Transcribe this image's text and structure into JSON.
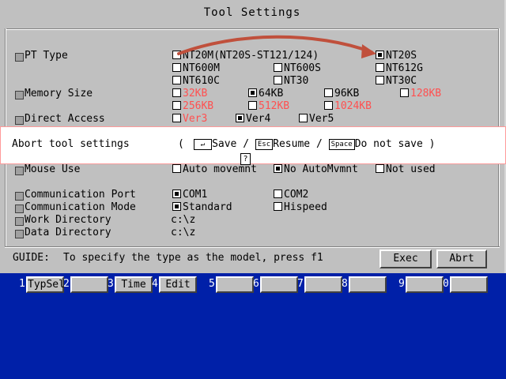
{
  "window": {
    "title": "Tool Settings"
  },
  "settings": {
    "pt_type": {
      "label": "PT Type",
      "options": [
        "NT20M(NT20S-ST121/124)",
        "NT20S",
        "NT600M",
        "NT600S",
        "NT612G",
        "NT610C",
        "NT30",
        "NT30C"
      ],
      "selected": "NT20S"
    },
    "memory_size": {
      "label": "Memory Size",
      "options": [
        "32KB",
        "64KB",
        "96KB",
        "128KB",
        "256KB",
        "512KB",
        "1024KB"
      ],
      "selected": "64KB"
    },
    "direct_access": {
      "label": "Direct Access",
      "options": [
        "Ver3",
        "Ver4",
        "Ver5"
      ],
      "selected": "Ver4"
    },
    "mouse_use": {
      "label": "Mouse Use",
      "options": [
        "Auto movemnt",
        "No AutoMvmnt",
        "Not used"
      ],
      "selected": "No AutoMvmnt"
    },
    "comm_port": {
      "label": "Communication Port",
      "options": [
        "COM1",
        "COM2"
      ],
      "selected": "COM1"
    },
    "comm_mode": {
      "label": "Communication Mode",
      "options": [
        "Standard",
        "Hispeed"
      ],
      "selected": "Standard"
    },
    "work_dir": {
      "label": "Work Directory",
      "value": "c:\\z"
    },
    "data_dir": {
      "label": "Data Directory",
      "value": "c:\\z"
    }
  },
  "dialog": {
    "message": "Abort tool settings",
    "open_paren": "(",
    "enter_key": "↵",
    "save": "Save",
    "sep": "/",
    "esc_key": "Esc",
    "resume": "Resume",
    "space_key": "Space",
    "do_not_save": "Do not save",
    "close_paren": ")"
  },
  "cursor_glyph": "?",
  "guide": {
    "label": "GUIDE:",
    "text": "To specify the type as the model, press f1"
  },
  "buttons": {
    "exec": "Exec",
    "abort": "Abrt"
  },
  "function_keys": [
    {
      "num": "1",
      "label": "TypSel"
    },
    {
      "num": "2",
      "label": ""
    },
    {
      "num": "3",
      "label": "Time"
    },
    {
      "num": "4",
      "label": "Edit"
    },
    {
      "num": "5",
      "label": ""
    },
    {
      "num": "6",
      "label": ""
    },
    {
      "num": "7",
      "label": ""
    },
    {
      "num": "8",
      "label": ""
    },
    {
      "num": "9",
      "label": ""
    },
    {
      "num": "0",
      "label": ""
    }
  ],
  "colors": {
    "background": "#0020a8",
    "panel": "#c0c0c0",
    "unavailable_option": "#ff5050",
    "annotation_arrow": "#c0503c"
  }
}
